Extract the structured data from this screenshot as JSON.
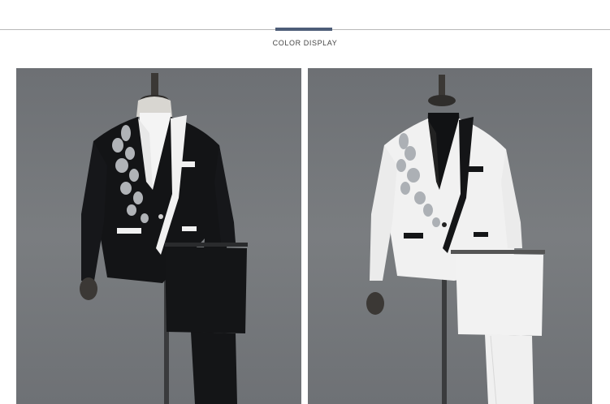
{
  "section": {
    "title": "COLOR DISPLAY"
  },
  "colors": {
    "accent": "#4d5d78",
    "background_gray": "#72757a",
    "black_suit": "#131416",
    "white_suit": "#f1f1f1"
  },
  "products": [
    {
      "variant": "black suit with white trim and silver embroidery"
    },
    {
      "variant": "white suit with black trim and silver embroidery"
    }
  ]
}
